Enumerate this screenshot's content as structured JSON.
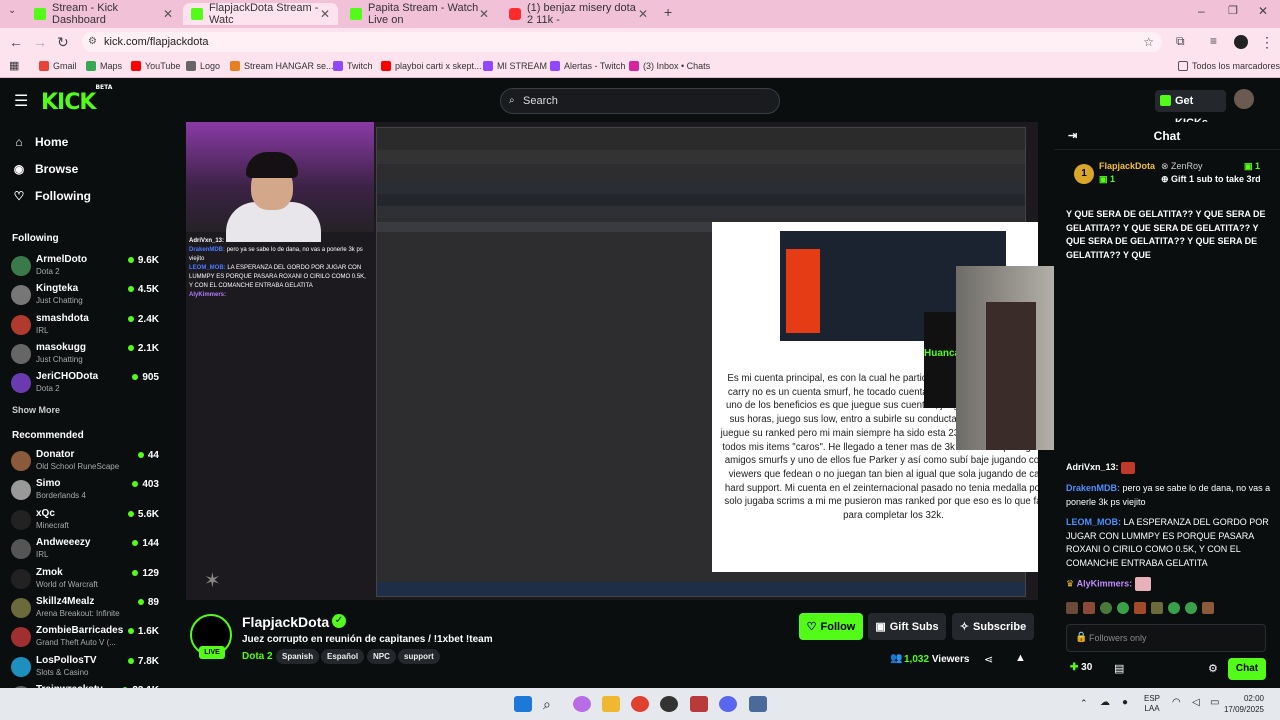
{
  "browser": {
    "tabs": [
      {
        "title": "Stream - Kick Dashboard",
        "color": "#53fc18",
        "active": false
      },
      {
        "title": "FlapjackDota Stream - Watc",
        "color": "#53fc18",
        "active": true
      },
      {
        "title": "Papita Stream - Watch Live on",
        "color": "#53fc18",
        "active": false
      },
      {
        "title": "(1) benjaz misery dota 2 11k -",
        "color": "#ff2a2a",
        "active": false
      }
    ],
    "url": "kick.com/flapjackdota",
    "bookmarks": [
      "Gmail",
      "Maps",
      "YouTube",
      "Logo",
      "Stream HANGAR se...",
      "Twitch",
      "playboi carti x skept...",
      "MI STREAM",
      "Alertas - Twitch",
      "(3) Inbox • Chats"
    ],
    "all_bookmarks": "Todos los marcadores"
  },
  "header": {
    "logo": "KICK",
    "logo_badge": "BETA",
    "search_placeholder": "Search",
    "get_kicks": "Get KICKs",
    "accent": "#53fc18"
  },
  "sidebar": {
    "nav": [
      {
        "label": "Home",
        "icon": "home-icon"
      },
      {
        "label": "Browse",
        "icon": "compass-icon"
      },
      {
        "label": "Following",
        "icon": "heart-icon"
      }
    ],
    "following_title": "Following",
    "following": [
      {
        "name": "ArmelDoto",
        "game": "Dota 2",
        "viewers": "9.6K",
        "color": "#3a7a4a"
      },
      {
        "name": "Kingteka",
        "game": "Just Chatting",
        "viewers": "4.5K",
        "color": "#777"
      },
      {
        "name": "smashdota",
        "game": "IRL",
        "viewers": "2.4K",
        "color": "#b03a2e"
      },
      {
        "name": "masokugg",
        "game": "Just Chatting",
        "viewers": "2.1K",
        "color": "#666"
      },
      {
        "name": "JeriCHODota",
        "game": "Dota 2",
        "viewers": "905",
        "color": "#6a3ab0"
      }
    ],
    "show_more": "Show More",
    "recommended_title": "Recommended",
    "recommended": [
      {
        "name": "Donator",
        "game": "Old School RuneScape",
        "viewers": "44",
        "color": "#8a5a3a"
      },
      {
        "name": "Simo",
        "game": "Borderlands 4",
        "viewers": "403",
        "color": "#999"
      },
      {
        "name": "xQc",
        "game": "Minecraft",
        "viewers": "5.6K",
        "color": "#222"
      },
      {
        "name": "Andweeezy",
        "game": "IRL",
        "viewers": "144",
        "color": "#555"
      },
      {
        "name": "Zmok",
        "game": "World of Warcraft",
        "viewers": "129",
        "color": "#222"
      },
      {
        "name": "Skillz4Mealz",
        "game": "Arena Breakout: Infinite",
        "viewers": "89",
        "color": "#6a6a3a"
      },
      {
        "name": "ZombieBarricades",
        "game": "Grand Theft Auto V (...",
        "viewers": "1.6K",
        "color": "#a03030"
      },
      {
        "name": "LosPollosTV",
        "game": "Slots & Casino",
        "viewers": "7.8K",
        "color": "#1e90c0"
      },
      {
        "name": "Trainwreckstv",
        "game": "",
        "viewers": "23.1K",
        "color": "#666"
      }
    ]
  },
  "video": {
    "overlay_chat": [
      {
        "user": "AdriVxn_13:",
        "text": "",
        "color": "#fff"
      },
      {
        "user": "DrakenMDB:",
        "text": "pero ya se sabe lo de dana, no vas a ponerle 3k ps viejito",
        "color": "#4a7aff"
      },
      {
        "user": "LEOM_MOB:",
        "text": "LA ESPERANZA DEL GORDO POR JUGAR CON LUMMPY ES PORQUE PASARA ROXANI O CIRILO COMO 0.5K, Y CON EL COMANCHE ENTRABA GELATITA",
        "color": "#4a7aff"
      },
      {
        "user": "AlyKimmers:",
        "text": "",
        "color": "#b07aff"
      }
    ],
    "doc_text": "Es mi cuenta principal, es con la cual he participado en torneos femeninos de carry no es un cuenta smurf, he tocado cuentas de mis seguidores si por que uno de los beneficios es que juegue sus cuentas, juego turbos para completar sus horas, juego sus low, entro a subirle su conducta, algunos me piden que juegue su ranked pero mi main siempre ha sido esta 230887591 es donde tengo todos mis items \"caros\". He llegado a tener mas de 3k de mmr sí pero gracias a amigos smurfs y uno de ellos fue Parker y así como subí baje jugando con mis viewers que fedean o no juegan tan bien al igual que sola jugando de carry y hard support. Mi cuenta en el zeinternacional pasado no tenia medalla por que solo jugaba scrims a mi me pusieron mas ranked por que eso es lo que faltaba para completar los 32k.",
    "side_peek_text": "Huanca sigue"
  },
  "stream": {
    "channel": "FlapjackDota",
    "live": "LIVE",
    "title": "Juez corrupto en reunión de capitanes / !1xbet !team",
    "category": "Dota 2",
    "tags": [
      "Spanish",
      "Español",
      "NPC",
      "support"
    ],
    "follow": "Follow",
    "gift_subs": "Gift Subs",
    "subscribe": "Subscribe",
    "viewers": "1,032",
    "viewers_label": "Viewers"
  },
  "chat": {
    "title": "Chat",
    "pinned": {
      "user": "FlapjackDota",
      "count": "1",
      "gifter": "ZenRoy",
      "gifter_count": "1",
      "text": "Gift 1 sub to take 3rd"
    },
    "spam_line": "Y QUE SERA DE GELATITA?? Y QUE SERA DE GELATITA?? Y QUE SERA DE GELATITA?? Y QUE SERA DE GELATITA?? Y QUE SERA DE GELATITA?? Y QUE",
    "messages": [
      {
        "user": "AdriVxn_13:",
        "text": "",
        "color": "#fff"
      },
      {
        "user": "DrakenMDB:",
        "text": "pero ya se sabe lo de dana, no vas a ponerle 3k ps viejito",
        "color": "#4a90ff"
      },
      {
        "user": "LEOM_MOB:",
        "text": "LA ESPERANZA DEL GORDO POR JUGAR CON LUMMPY ES PORQUE PASARA ROXANI O CIRILO COMO 0.5K, Y CON EL COMANCHE ENTRABA GELATITA",
        "color": "#4a90ff"
      },
      {
        "user": "AlyKimmers:",
        "text": "",
        "color": "#c08aff"
      }
    ],
    "input_placeholder": "Followers only",
    "points": "30",
    "send": "Chat"
  },
  "taskbar": {
    "lang": "ESP",
    "lang2": "LAA",
    "time": "02:00",
    "date": "17/09/2025"
  }
}
